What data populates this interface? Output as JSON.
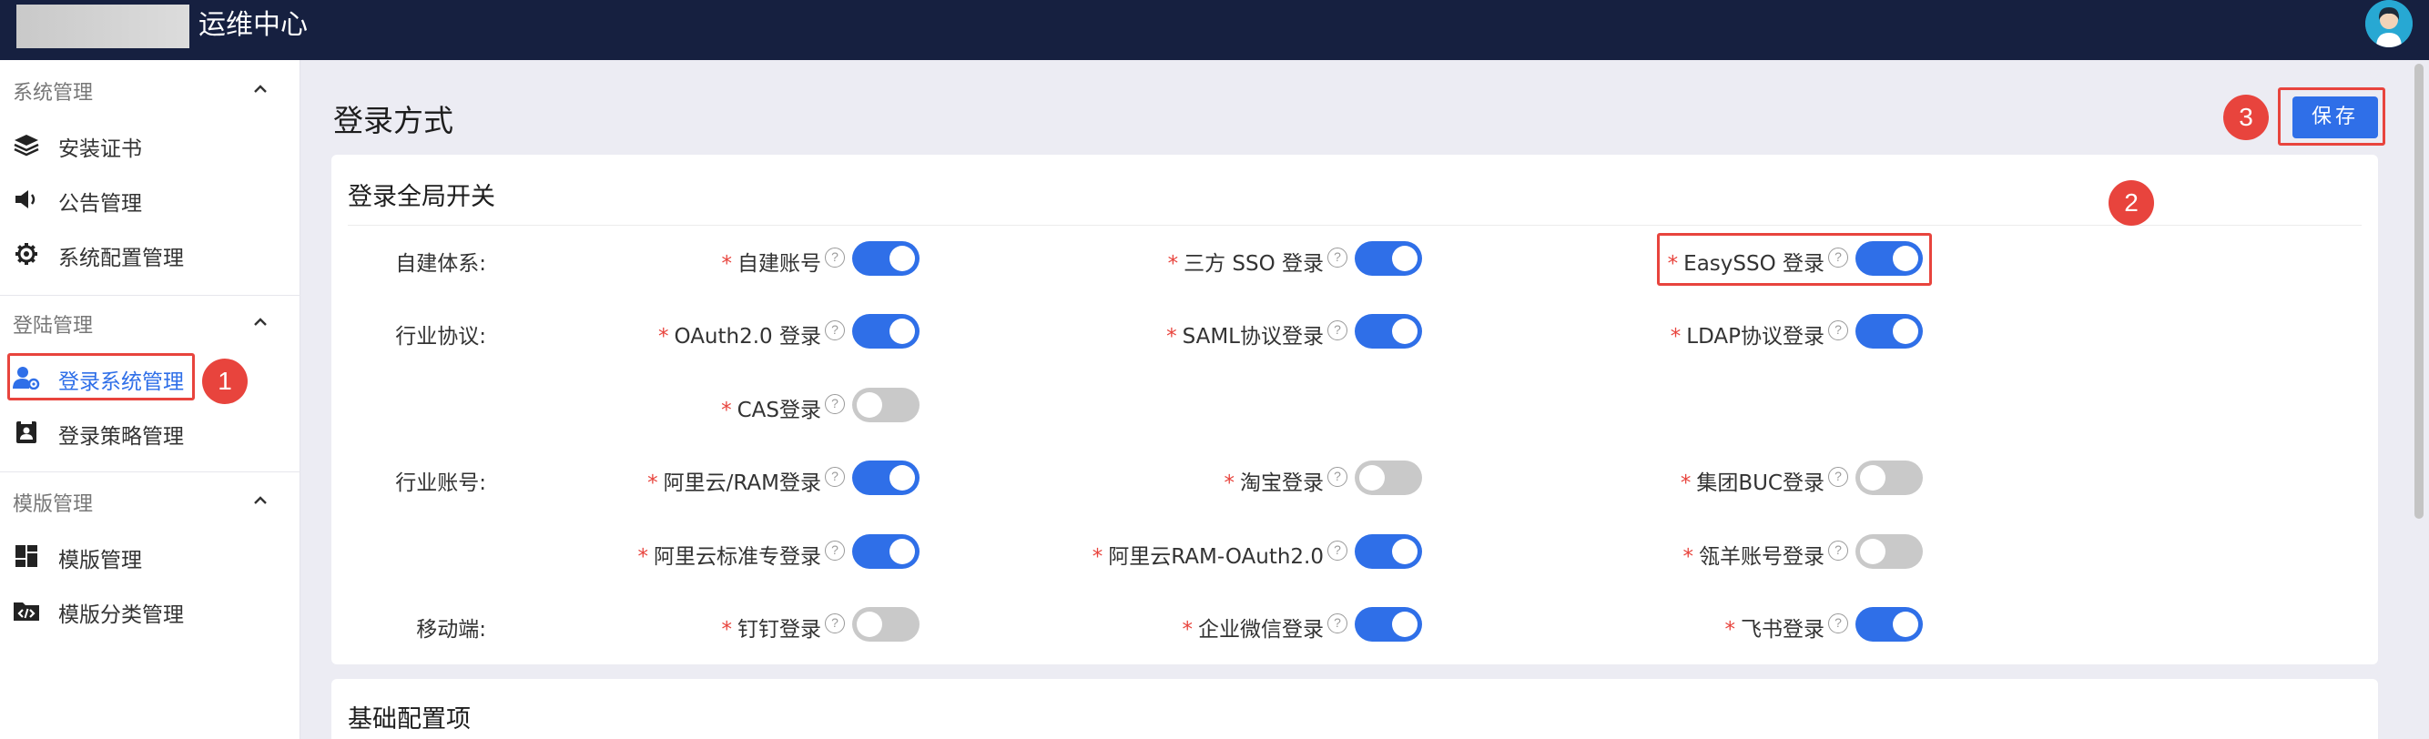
{
  "header": {
    "app_title": "运维中心",
    "avatar_icon": "user-avatar-icon"
  },
  "sidebar": {
    "groups": [
      {
        "title": "系统管理",
        "items": [
          {
            "label": "安装证书",
            "icon": "layers-icon"
          },
          {
            "label": "公告管理",
            "icon": "megaphone-icon"
          },
          {
            "label": "系统配置管理",
            "icon": "gear-icon"
          }
        ]
      },
      {
        "title": "登陆管理",
        "items": [
          {
            "label": "登录系统管理",
            "icon": "user-settings-icon",
            "active": true
          },
          {
            "label": "登录策略管理",
            "icon": "id-card-icon"
          }
        ]
      },
      {
        "title": "模版管理",
        "items": [
          {
            "label": "模版管理",
            "icon": "dashboard-icon"
          },
          {
            "label": "模版分类管理",
            "icon": "code-folder-icon"
          }
        ]
      }
    ]
  },
  "main": {
    "page_title": "登录方式",
    "save_label": "保存",
    "card1": {
      "title": "登录全局开关",
      "rows": [
        {
          "label": "自建体系:",
          "fields": [
            {
              "label": "自建账号",
              "on": true
            },
            {
              "label": "三方 SSO 登录",
              "on": true
            },
            {
              "label": "EasySSO 登录",
              "on": true
            }
          ]
        },
        {
          "label": "行业协议:",
          "fields": [
            {
              "label": "OAuth2.0 登录",
              "on": true
            },
            {
              "label": "SAML协议登录",
              "on": true
            },
            {
              "label": "LDAP协议登录",
              "on": true
            }
          ]
        },
        {
          "label": "",
          "fields": [
            {
              "label": "CAS登录",
              "on": false
            }
          ]
        },
        {
          "label": "行业账号:",
          "fields": [
            {
              "label": "阿里云/RAM登录",
              "on": true
            },
            {
              "label": "淘宝登录",
              "on": false
            },
            {
              "label": "集团BUC登录",
              "on": false
            }
          ]
        },
        {
          "label": "",
          "fields": [
            {
              "label": "阿里云标准专登录",
              "on": true
            },
            {
              "label": "阿里云RAM-OAuth2.0",
              "on": true
            },
            {
              "label": "瓴羊账号登录",
              "on": false
            }
          ]
        },
        {
          "label": "移动端:",
          "fields": [
            {
              "label": "钉钉登录",
              "on": false
            },
            {
              "label": "企业微信登录",
              "on": true
            },
            {
              "label": "飞书登录",
              "on": true
            }
          ]
        }
      ]
    },
    "card2": {
      "title": "基础配置项"
    }
  },
  "annotations": {
    "step1": "1",
    "step2": "2",
    "step3": "3"
  },
  "symbols": {
    "required": "*",
    "help": "?"
  },
  "colors": {
    "primary": "#2f6fe8",
    "topbar": "#162040",
    "annotation": "#e8443d"
  }
}
